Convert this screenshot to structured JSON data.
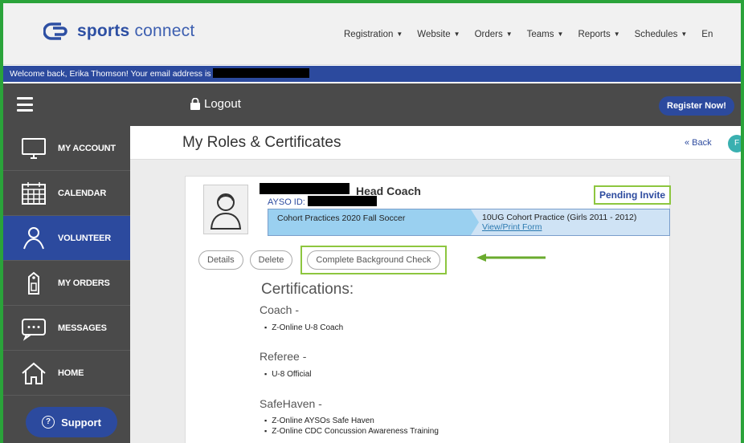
{
  "header": {
    "brand_bold": "sports",
    "brand_light": "connect",
    "nav": [
      "Registration",
      "Website",
      "Orders",
      "Teams",
      "Reports",
      "Schedules",
      "En"
    ]
  },
  "welcome": {
    "text": "Welcome back, Erika Thomson! Your email address is"
  },
  "toolbar": {
    "logout_label": "Logout",
    "register_label": "Register Now!"
  },
  "sidebar": {
    "items": [
      {
        "label": "MY ACCOUNT",
        "icon": "monitor-icon"
      },
      {
        "label": "CALENDAR",
        "icon": "calendar-icon"
      },
      {
        "label": "VOLUNTEER",
        "icon": "volunteer-icon",
        "active": true
      },
      {
        "label": "MY ORDERS",
        "icon": "tag-icon"
      },
      {
        "label": "MESSAGES",
        "icon": "message-icon"
      },
      {
        "label": "HOME",
        "icon": "home-icon"
      }
    ],
    "support_label": "Support"
  },
  "main": {
    "title": "My Roles & Certificates",
    "back_label": "« Back",
    "back_bubble": "F"
  },
  "role_card": {
    "role": "Head Coach",
    "ayso_label": "AYSO ID:",
    "status": "Pending Invite",
    "program": "Cohort Practices 2020 Fall Soccer",
    "division": "10UG Cohort Practice (Girls 2011 - 2012)",
    "form_link": "View/Print Form",
    "buttons": {
      "details": "Details",
      "delete": "Delete",
      "background": "Complete Background Check"
    }
  },
  "certifications": {
    "title": "Certifications:",
    "sections": [
      {
        "name": "Coach -",
        "items": [
          "Z-Online U-8 Coach"
        ]
      },
      {
        "name": "Referee -",
        "items": [
          "U-8 Official"
        ]
      },
      {
        "name": "SafeHaven -",
        "items": [
          "Z-Online AYSOs Safe Haven",
          "Z-Online CDC Concussion Awareness Training"
        ]
      }
    ]
  },
  "colors": {
    "accent": "#2c4a9e",
    "dark": "#4a4a4a",
    "highlight": "#8dc63f",
    "frame": "#2aa33a"
  }
}
